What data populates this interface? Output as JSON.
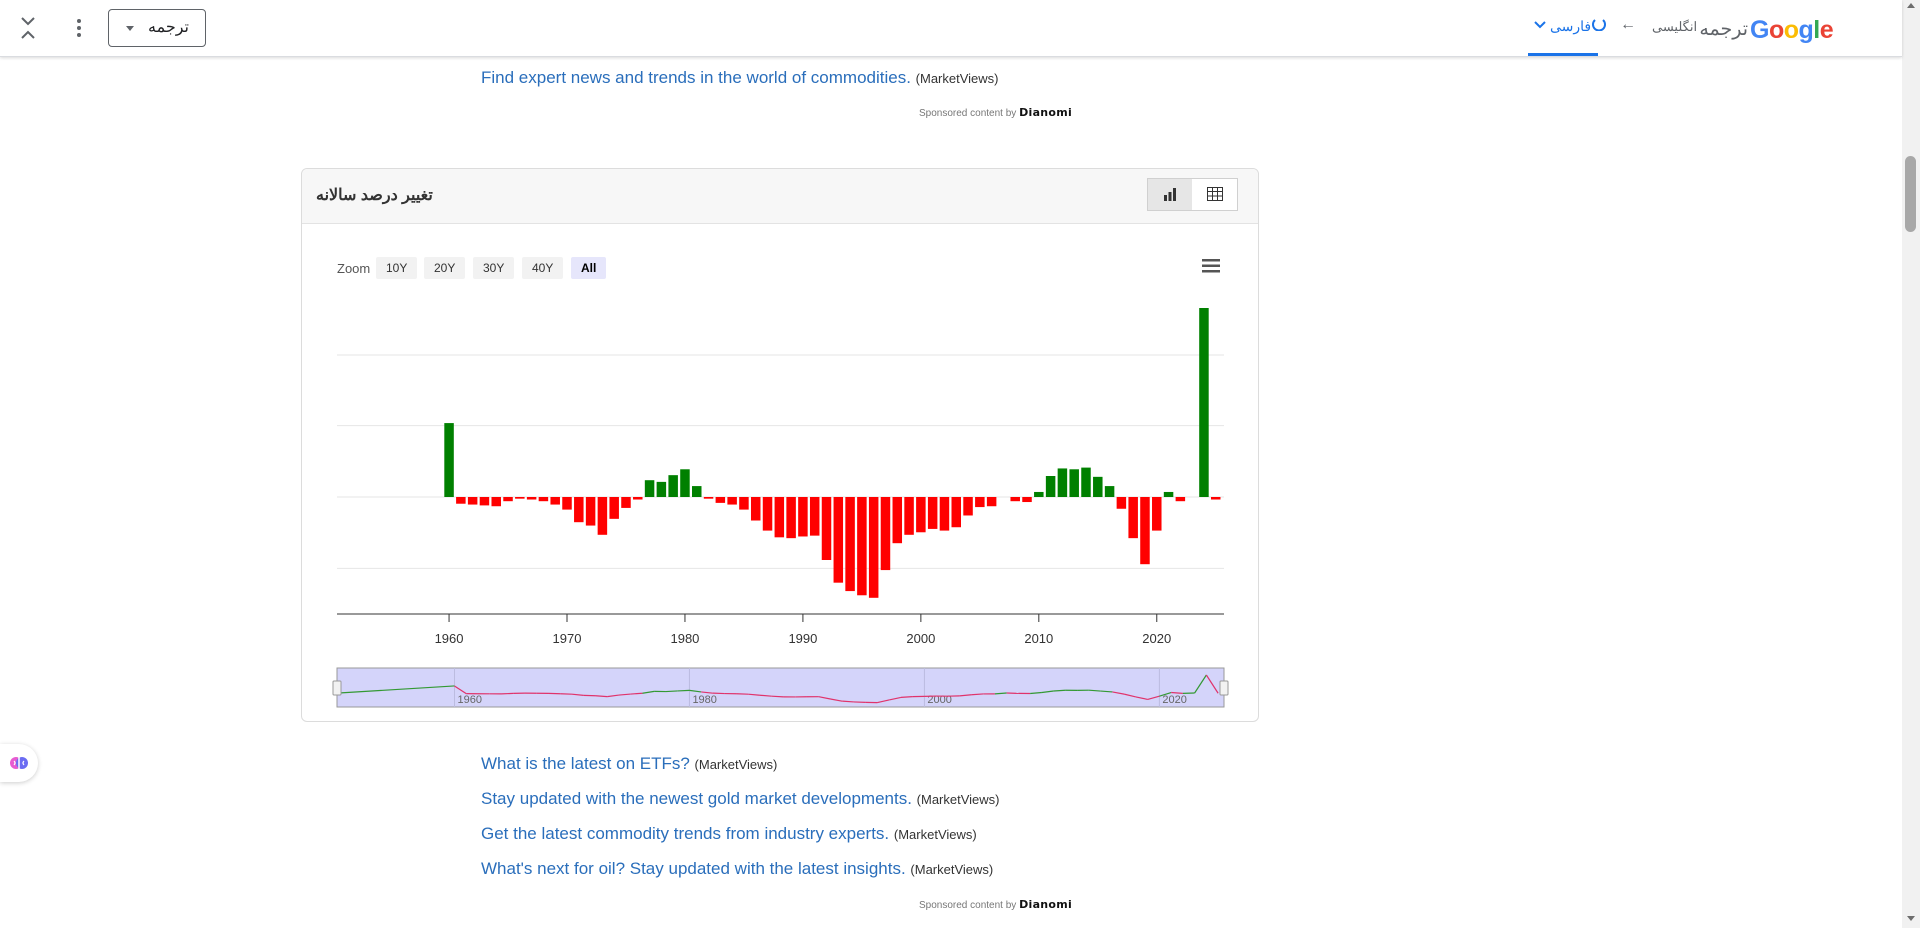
{
  "translate_bar": {
    "mode_label": "ترجمه",
    "target_language": "فارسی",
    "source_language": "انگلیسی",
    "brand_google": "Google",
    "brand_translate": "ترجمه",
    "icons": [
      "collapse-icon",
      "more-vert-icon",
      "dropdown-caret-icon",
      "chevron-down-icon",
      "spinner-icon",
      "arrow-left-icon",
      "google-logo"
    ]
  },
  "top_link": {
    "text": "Find expert news and trends in the world of commodities.",
    "source": "(MarketViews)"
  },
  "sponsor_top": {
    "text": "Sponsored content by",
    "brand": "Dianomi"
  },
  "chart_panel": {
    "title": "تغییر درصد سالانه",
    "zoom": {
      "label": "Zoom",
      "options": [
        "10Y",
        "20Y",
        "30Y",
        "40Y",
        "All"
      ],
      "selected": "All"
    }
  },
  "chart_data": {
    "type": "bar",
    "title": "تغییر درصد سالانه",
    "x_ticks": [
      1960,
      1970,
      1980,
      1990,
      2000,
      2010,
      2020
    ],
    "xlim": [
      1950.5,
      2025.7
    ],
    "ylim": [
      -140,
      200
    ],
    "grid": "horizontal",
    "colors": {
      "positive": "#008000",
      "negative": "#ff0000"
    },
    "years": [
      1960,
      1961,
      1962,
      1963,
      1964,
      1965,
      1966,
      1967,
      1968,
      1969,
      1970,
      1971,
      1972,
      1973,
      1974,
      1975,
      1976,
      1977,
      1978,
      1979,
      1980,
      1981,
      1982,
      1983,
      1984,
      1985,
      1986,
      1987,
      1988,
      1989,
      1990,
      1991,
      1992,
      1993,
      1994,
      1995,
      1996,
      1997,
      1998,
      1999,
      2000,
      2001,
      2002,
      2003,
      2004,
      2005,
      2006,
      2007,
      2008,
      2009,
      2010,
      2011,
      2012,
      2013,
      2014,
      2015,
      2016,
      2017,
      2018,
      2019,
      2020,
      2021,
      2022,
      2023,
      2024,
      2025
    ],
    "values": [
      88,
      -8,
      -9,
      -10,
      -11,
      -5,
      -2,
      -3,
      -5,
      -9,
      -15,
      -30,
      -34,
      -45,
      -26,
      -13,
      -3,
      20,
      18,
      26,
      33,
      13,
      -2,
      -7,
      -9,
      -15,
      -28,
      -40,
      -48,
      -49,
      -47,
      -46,
      -75,
      -102,
      -112,
      -117,
      -120,
      -87,
      -55,
      -45,
      -42,
      -38,
      -40,
      -36,
      -22,
      -12,
      -11,
      0,
      -5,
      -6,
      6,
      25,
      34,
      33,
      35,
      24,
      13,
      -14,
      -49,
      -80,
      -40,
      6,
      -5,
      0,
      225,
      -3
    ],
    "navigator_ticks": [
      1960,
      1980,
      2000,
      2020
    ]
  },
  "bottom_links": [
    {
      "text": "What is the latest on ETFs?",
      "source": "(MarketViews)"
    },
    {
      "text": "Stay updated with the newest gold market developments.",
      "source": "(MarketViews)"
    },
    {
      "text": "Get the latest commodity trends from industry experts.",
      "source": "(MarketViews)"
    },
    {
      "text": "What's next for oil? Stay updated with the latest insights.",
      "source": "(MarketViews)"
    }
  ],
  "sponsor_bottom": {
    "text": "Sponsored content by",
    "brand": "Dianomi"
  }
}
